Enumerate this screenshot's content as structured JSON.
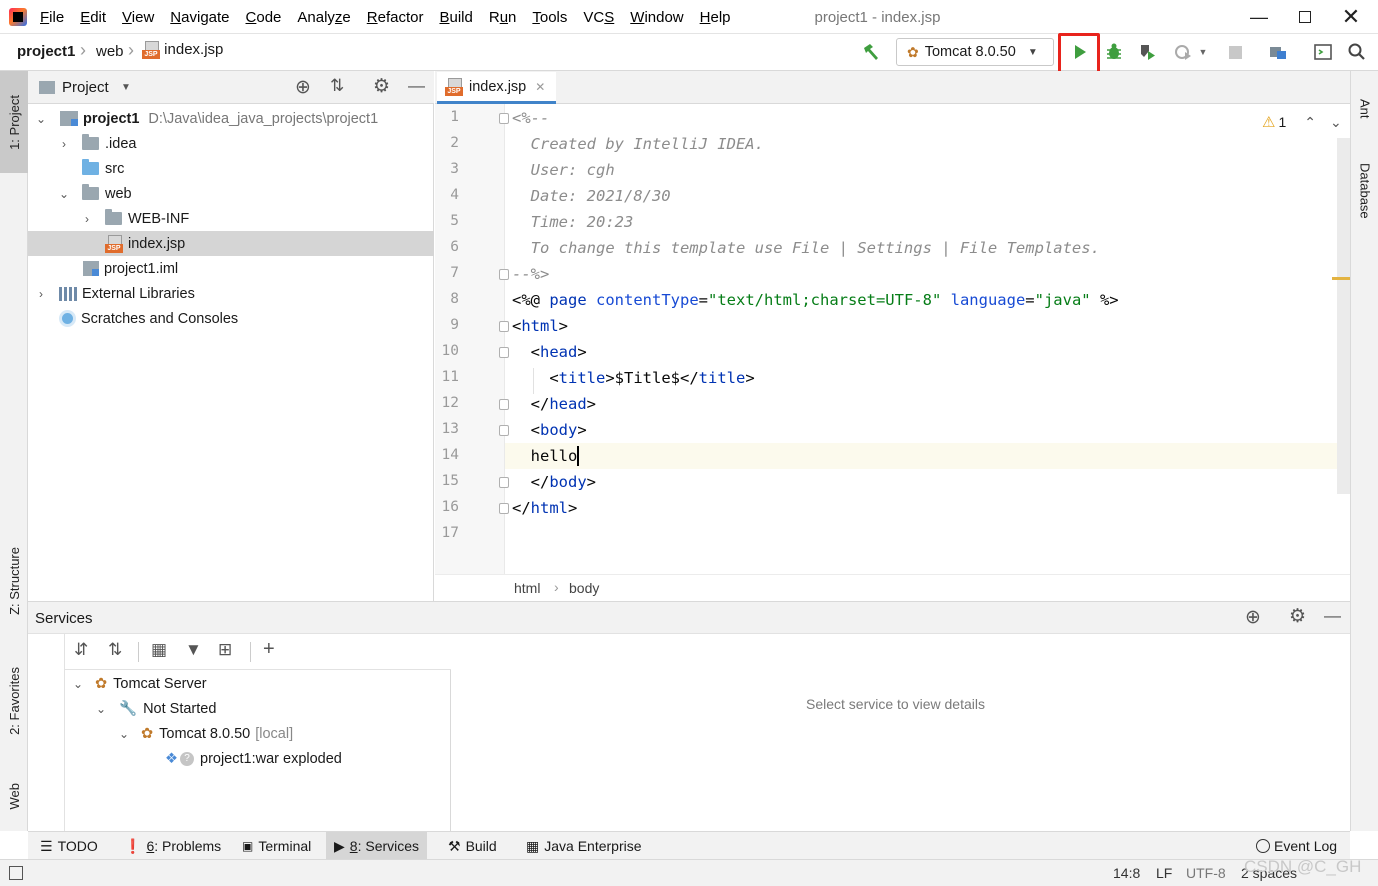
{
  "menu": [
    "File",
    "Edit",
    "View",
    "Navigate",
    "Code",
    "Analyze",
    "Refactor",
    "Build",
    "Run",
    "Tools",
    "VCS",
    "Window",
    "Help"
  ],
  "menu_underline": [
    "F",
    "E",
    "V",
    "N",
    "C",
    "z",
    "R",
    "B",
    "u",
    "T",
    "S",
    "W",
    "H"
  ],
  "window_title": "project1 - index.jsp",
  "breadcrumb": {
    "project": "project1",
    "folder": "web",
    "file": "index.jsp"
  },
  "run_config": "Tomcat 8.0.50",
  "left_tabs": {
    "project": "1: Project",
    "structure": "Z: Structure",
    "favorites": "2: Favorites",
    "web": "Web"
  },
  "right_tabs": {
    "ant": "Ant",
    "database": "Database"
  },
  "project_panel": {
    "title": "Project",
    "tree": [
      {
        "label": "project1",
        "path": "D:\\Java\\idea_java_projects\\project1"
      },
      {
        "label": ".idea"
      },
      {
        "label": "src"
      },
      {
        "label": "web"
      },
      {
        "label": "WEB-INF"
      },
      {
        "label": "index.jsp"
      },
      {
        "label": "project1.iml"
      },
      {
        "label": "External Libraries"
      },
      {
        "label": "Scratches and Consoles"
      }
    ]
  },
  "editor": {
    "tab": "index.jsp",
    "warnings": "1",
    "line_numbers": [
      "1",
      "2",
      "3",
      "4",
      "5",
      "6",
      "7",
      "8",
      "9",
      "10",
      "11",
      "12",
      "13",
      "14",
      "15",
      "16",
      "17"
    ],
    "lines": {
      "l1": "<%--",
      "l2": "  Created by IntelliJ IDEA.",
      "l3": "  User: cgh",
      "l4": "  Date: 2021/8/30",
      "l5": "  Time: 20:23",
      "l6": "  To change this template use File | Settings | File Templates.",
      "l7": "--%>",
      "l8": {
        "open": "<%@ ",
        "page": "page",
        "ct_attr": "contentType",
        "eq1": "=",
        "ct_val": "\"text/html;charset=UTF-8\"",
        "lang_attr": "language",
        "eq2": "=",
        "lang_val": "\"java\"",
        "close": " %>"
      },
      "l9": {
        "lt": "<",
        "name": "html",
        "gt": ">"
      },
      "l10": {
        "lt": "  <",
        "name": "head",
        "gt": ">"
      },
      "l11": {
        "lt": "    <",
        "name": "title",
        "mid": ">$Title$</",
        "name2": "title",
        "gt": ">"
      },
      "l12": {
        "lt": "  </",
        "name": "head",
        "gt": ">"
      },
      "l13": {
        "lt": "  <",
        "name": "body",
        "gt": ">"
      },
      "l14": "  hello",
      "l15": {
        "lt": "  </",
        "name": "body",
        "gt": ">"
      },
      "l16": {
        "lt": "</",
        "name": "html",
        "gt": ">"
      }
    },
    "breadcrumb": [
      "html",
      "body"
    ]
  },
  "services": {
    "title": "Services",
    "tree": [
      {
        "label": "Tomcat Server"
      },
      {
        "label": "Not Started"
      },
      {
        "label": "Tomcat 8.0.50",
        "suffix": "[local]"
      },
      {
        "label": "project1:war exploded"
      }
    ],
    "detail_placeholder": "Select service to view details"
  },
  "bottom_tabs": [
    {
      "label": "TODO"
    },
    {
      "prefix": "6",
      "label": ": Problems"
    },
    {
      "label": "Terminal"
    },
    {
      "prefix": "8",
      "label": ": Services"
    },
    {
      "label": "Build"
    },
    {
      "label": "Java Enterprise"
    }
  ],
  "event_log": "Event Log",
  "status": {
    "position": "14:8",
    "line_sep": "LF",
    "encoding": "UTF-8",
    "indent": "2 spaces",
    "watermark": "CSDN @C_GH"
  },
  "colors": {
    "accent_tab": "#4083c9",
    "highlight": "#e8231c",
    "run_green": "#3f9e3f",
    "comment": "#8c8c8c",
    "tag": "#0033b3",
    "string": "#067d17"
  }
}
